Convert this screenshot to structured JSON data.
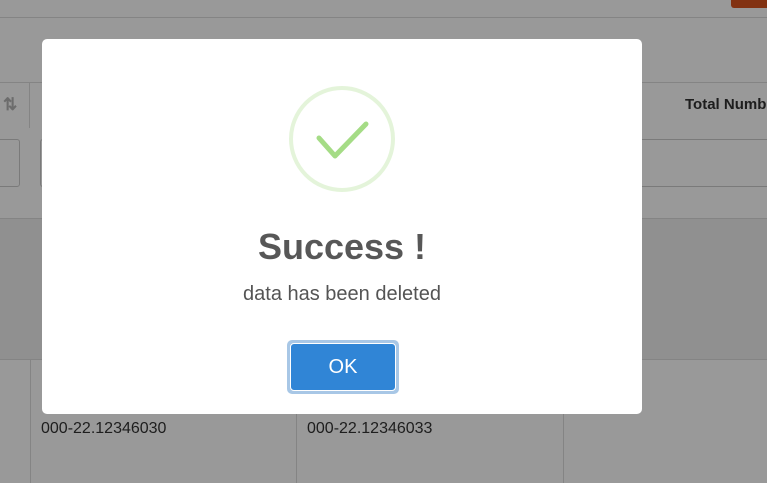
{
  "background_table": {
    "sort_icon": "⇅",
    "header_total": "Total Numb",
    "rows": [
      {
        "col1": "000-22.12346030",
        "col2": "000-22.12346033"
      }
    ]
  },
  "dialog": {
    "icon": "success-check-icon",
    "title": "Success !",
    "message": "data has been deleted",
    "ok_label": "OK"
  },
  "colors": {
    "accent": "#3085d6",
    "success": "#a5dc86",
    "top_button": "#d9541e"
  }
}
